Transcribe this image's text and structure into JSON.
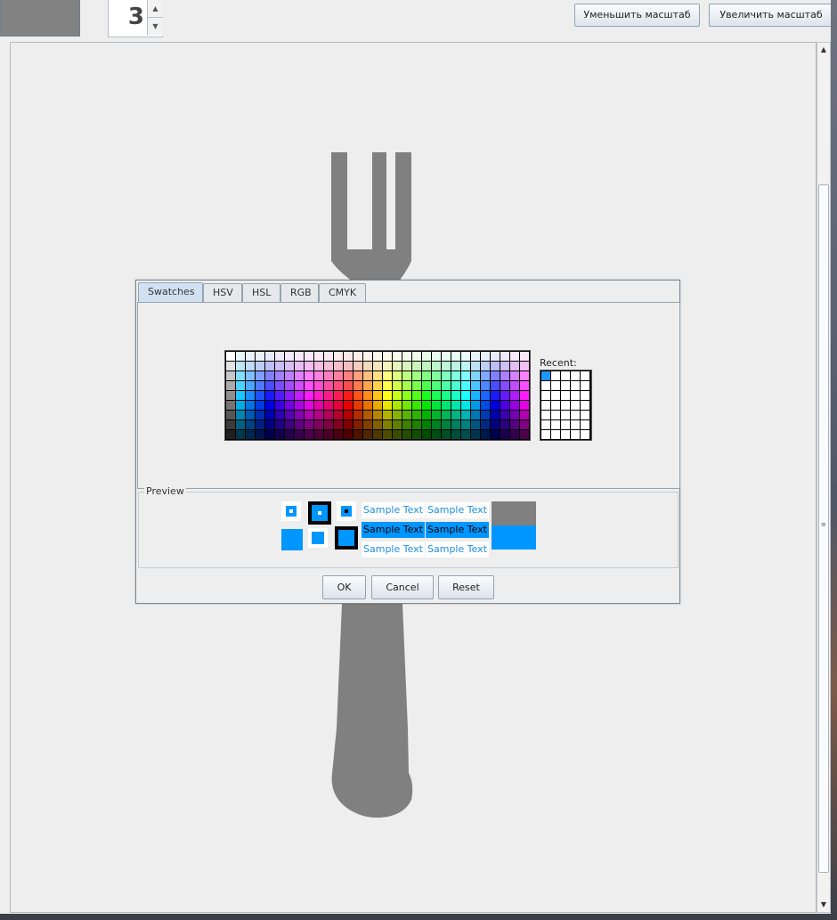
{
  "toolbar": {
    "color_preview": "#828282",
    "spinner_value": "3",
    "spin_up_icon": "▲",
    "spin_down_icon": "▼",
    "zoom_out_label": "Уменьшить масштаб",
    "zoom_in_label": "Увеличить масштаб"
  },
  "canvas": {
    "background": "#eeeeee",
    "shape": "fork",
    "shape_color": "#808080"
  },
  "scrollbar": {
    "up_icon": "▲",
    "down_icon": "▼",
    "grip_icon": "≡"
  },
  "dialog": {
    "tabs": [
      "Swatches",
      "HSV",
      "HSL",
      "RGB",
      "CMYK"
    ],
    "active_tab": "Swatches",
    "recent_label": "Recent:",
    "recent_colors": [
      "#1e96ff"
    ],
    "preview": {
      "label": "Preview",
      "selected_color": "#0096ff",
      "old_color": "#808080",
      "sample_text": "Sample Text"
    },
    "buttons": {
      "ok": "OK",
      "cancel": "Cancel",
      "reset": "Reset"
    }
  }
}
